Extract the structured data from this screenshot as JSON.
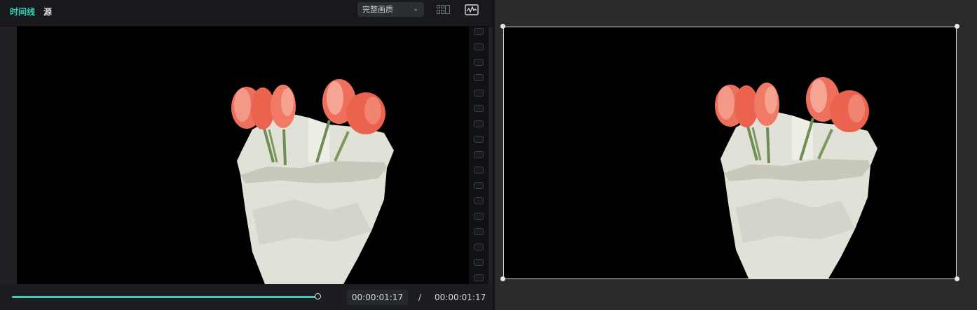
{
  "tabs": {
    "timeline": "时间线",
    "source": "源"
  },
  "quality": {
    "selected": "完整画质",
    "icon": "chevron-down-icon"
  },
  "toolbar_icons": [
    "layout-grid-icon",
    "waveform-scope-icon"
  ],
  "playback": {
    "progress": 1.0,
    "current_time": "00:00:01:17",
    "separator": "/",
    "total_time": "00:00:01:17"
  },
  "colors": {
    "accent": "#33d2b5",
    "petal": "#ee6f5c",
    "wrap_paper": "#e4e4dc",
    "stem": "#6f8e54"
  }
}
